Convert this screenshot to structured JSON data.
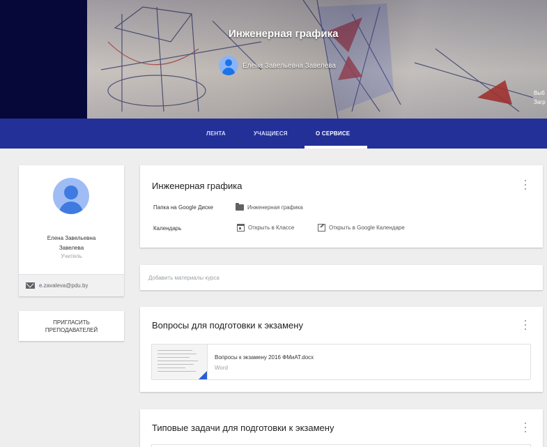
{
  "banner": {
    "course_title": "Инженерная графика",
    "teacher_name": "Елена Завельевна Завелева",
    "side_text_1": "Выб",
    "side_text_2": "Загр"
  },
  "nav": {
    "tabs": [
      {
        "label": "ЛЕНТА",
        "active": false
      },
      {
        "label": "УЧАЩИЕСЯ",
        "active": false
      },
      {
        "label": "О СЕРВИСЕ",
        "active": true
      }
    ]
  },
  "profile": {
    "name_line1": "Елена Завельевна",
    "name_line2": "Завелева",
    "role": "Учитель",
    "email": "e.zavaleva@pdu.by",
    "invite_line1": "ПРИГЛАСИТЬ",
    "invite_line2": "ПРЕПОДАВАТЕЛЕЙ"
  },
  "about": {
    "title": "Инженерная графика",
    "drive_label": "Папка на Google Диске",
    "drive_value": "Инженерная графика",
    "calendar_label": "Календарь",
    "open_in_class": "Открыть в Классе",
    "open_in_calendar": "Открыть в Google Календаре"
  },
  "add_materials": {
    "placeholder": "Добавить материалы курса"
  },
  "topics": [
    {
      "title": "Вопросы для подготовки к экзамену",
      "attachment_name": "Вопросы к экзамену 2016 ФМиАТ.docx",
      "attachment_type": "Word"
    },
    {
      "title": "Типовые задачи для подготовки к экзамену"
    }
  ],
  "colors": {
    "navbar": "#233097",
    "banner_dark": "#06083a",
    "accent": "#1a73e8"
  }
}
